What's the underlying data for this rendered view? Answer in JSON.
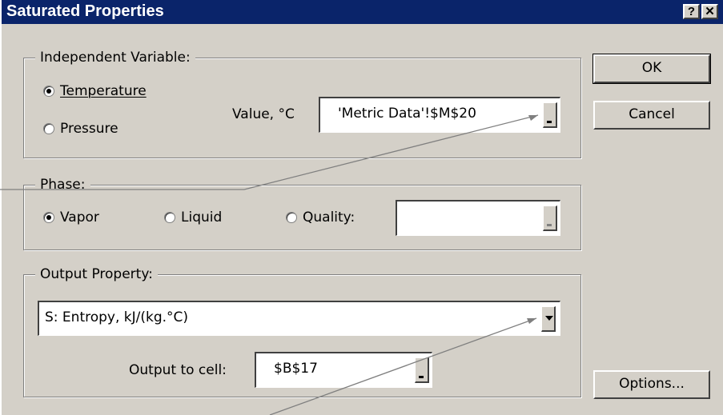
{
  "window": {
    "title": "Saturated Properties",
    "help_glyph": "?",
    "close_glyph": "✕"
  },
  "independent": {
    "legend": "Independent Variable:",
    "temperature_label": "Temperature",
    "temperature_selected": true,
    "pressure_label": "Pressure",
    "pressure_selected": false,
    "value_label": "Value, °C",
    "value": "'Metric Data'!$M$20"
  },
  "phase": {
    "legend": "Phase:",
    "vapor_label": "Vapor",
    "vapor_selected": true,
    "liquid_label": "Liquid",
    "liquid_selected": false,
    "quality_label": "Quality:",
    "quality_selected": false,
    "quality_value": ""
  },
  "output": {
    "legend": "Output Property:",
    "property_selected": "S: Entropy, kJ/(kg.°C)",
    "cell_label": "Output to cell:",
    "cell_value": "$B$17"
  },
  "buttons": {
    "ok": "OK",
    "cancel": "Cancel",
    "options": "Options..."
  },
  "colors": {
    "titlebar": "#0a246a",
    "face": "#d4d0c8",
    "callout_line": "#7f7f7f"
  },
  "icons": {
    "help": "question-mark-icon",
    "close": "close-icon",
    "ref_button": "range-select-icon",
    "dropdown": "chevron-down-icon"
  }
}
